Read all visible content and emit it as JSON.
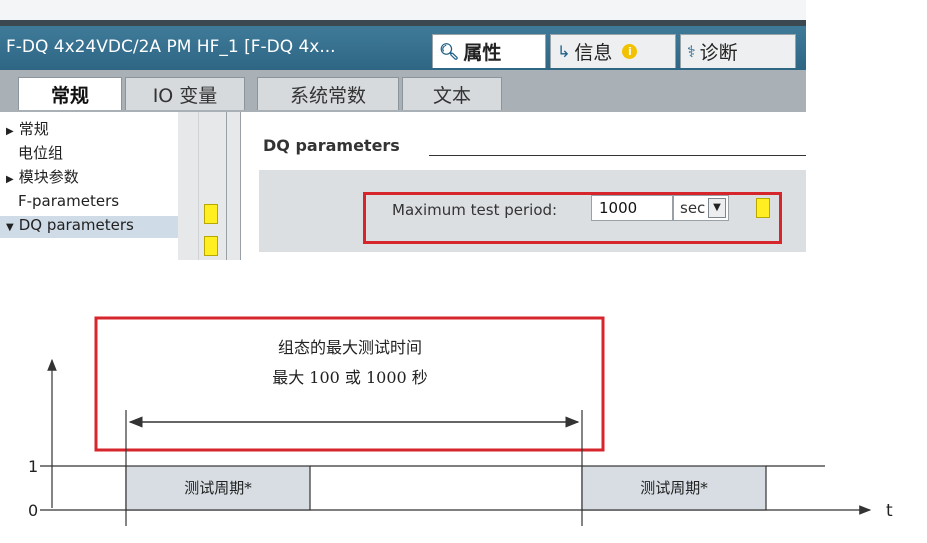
{
  "window": {
    "title": "F-DQ 4x24VDC/2A PM HF_1 [F-DQ 4x...",
    "tabs": [
      {
        "label": "属性",
        "icon": "properties-icon"
      },
      {
        "label": "信息",
        "icon": "info-icon"
      },
      {
        "label": "诊断",
        "icon": "diagnostics-icon"
      }
    ]
  },
  "content_tabs": [
    "常规",
    "IO 变量",
    "系统常数",
    "文本"
  ],
  "nav": {
    "items": [
      {
        "label": "常规",
        "expander": "▶"
      },
      {
        "label": "电位组"
      },
      {
        "label": "模块参数",
        "expander": "▶"
      },
      {
        "label": "F-parameters"
      },
      {
        "label": "DQ parameters",
        "expander": "▼"
      }
    ]
  },
  "main": {
    "section_title": "DQ parameters",
    "max_test_period_label": "Maximum test period:",
    "max_test_period_value": "1000",
    "unit_value": "sec",
    "dropdown_glyph": "▼"
  },
  "diagram": {
    "config_title": "组态的最大测试时间",
    "config_range": "最大 100 或 1000 秒",
    "pulse_label_1": "测试周期*",
    "pulse_label_2": "测试周期*",
    "y_tick_1": "1",
    "y_tick_0": "0",
    "x_axis_label": "t"
  },
  "colors": {
    "highlight": "#d6262c",
    "titlebar": "#2e6684",
    "status_yellow": "#ffee22"
  }
}
